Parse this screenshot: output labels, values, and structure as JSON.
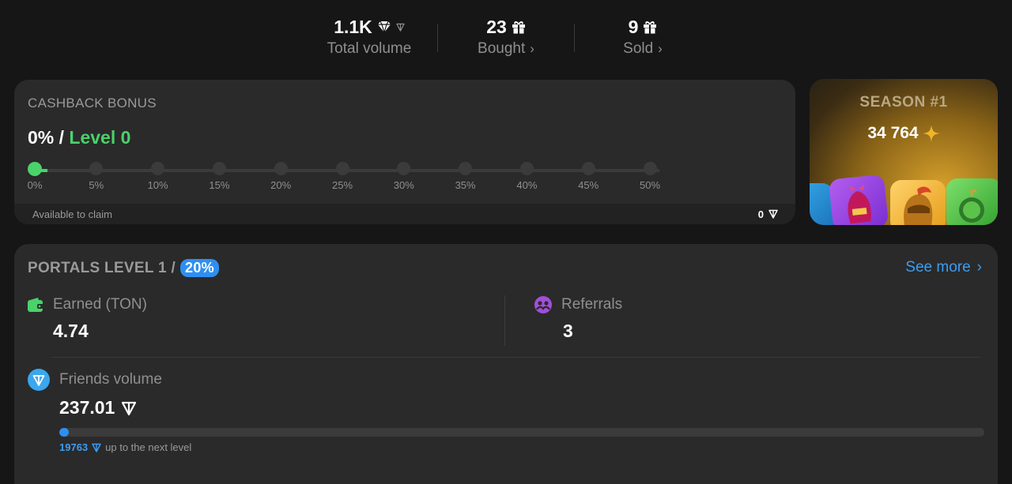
{
  "stats": [
    {
      "value": "1.1K",
      "label": "Total volume",
      "icon": "gem-icon"
    },
    {
      "value": "23",
      "label": "Bought",
      "icon": "gift-icon"
    },
    {
      "value": "9",
      "label": "Sold",
      "icon": "gift-icon"
    }
  ],
  "cashback": {
    "title": "CASHBACK BONUS",
    "percent": "0%",
    "separator": " / ",
    "level": "Level 0",
    "progress_fraction": 0.02,
    "ticks": [
      "0%",
      "5%",
      "10%",
      "15%",
      "20%",
      "25%",
      "30%",
      "35%",
      "40%",
      "45%",
      "50%"
    ],
    "claim_label": "Available to claim",
    "claim_amount": "0"
  },
  "season": {
    "title": "SEASON #1",
    "points": "34 764"
  },
  "portals": {
    "title": "PORTALS LEVEL 1 /",
    "badge": "20%",
    "see_more": "See more",
    "earned_label": "Earned (TON)",
    "earned_value": "4.74",
    "referrals_label": "Referrals",
    "referrals_value": "3",
    "friends_label": "Friends volume",
    "friends_value": "237.01",
    "progress_fraction": 0.01,
    "next_amount": "19763",
    "next_text": "up to the next level"
  },
  "colors": {
    "accent_green": "#4ad26b",
    "accent_blue": "#2e8ff0",
    "gold": "#f0b52a"
  }
}
